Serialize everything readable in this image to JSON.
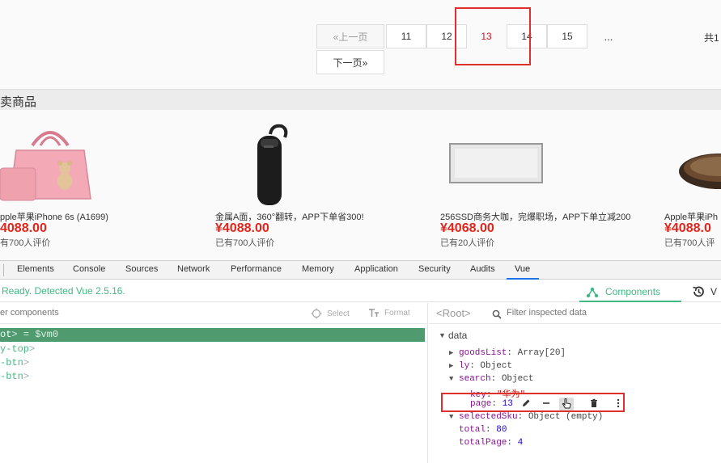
{
  "pagination": {
    "prev": "«上一页",
    "pages": [
      "11",
      "12",
      "13",
      "14",
      "15"
    ],
    "current": "13",
    "ellipsis": "...",
    "next": "下一页»",
    "total_fragment": "共1"
  },
  "section": {
    "title": "卖商品"
  },
  "products": [
    {
      "name": "pple苹果iPhone 6s (A1699)",
      "price": "4088.00",
      "reviews": "有700人评价",
      "image": "pink-handbag"
    },
    {
      "name": "金属A面，360°翻转，APP下单省300!",
      "price": "¥4088.00",
      "reviews": "已有700人评价",
      "image": "bluetooth-headset"
    },
    {
      "name": "256SSD商务大咖，完爆职场，APP下单立减200",
      "price": "¥4068.00",
      "reviews": "已有20人评价",
      "image": "led-panel"
    },
    {
      "name": "Apple苹果iPh",
      "price": "¥4088.0",
      "reviews": "已有700人评",
      "image": "frying-pan"
    }
  ],
  "devtools": {
    "tabs": [
      "Elements",
      "Console",
      "Sources",
      "Network",
      "Performance",
      "Memory",
      "Application",
      "Security",
      "Audits",
      "Vue"
    ],
    "active_tab": "Vue",
    "status": "Ready. Detected Vue 2.5.16.",
    "components_label": "Components",
    "vuex_label": "V",
    "filter_placeholder": "er components",
    "select_label": "Select",
    "format_label": "Format",
    "tree": [
      {
        "open": "ot",
        "close": "> = ",
        "ref": "$vm0",
        "selected": true
      },
      {
        "text": "y-top",
        "selected": false
      },
      {
        "text": "-btn",
        "selected": false
      },
      {
        "text": "-btn",
        "selected": false
      }
    ],
    "inspected": "<Root>",
    "inspect_placeholder": "Filter inspected data",
    "data_label": "data",
    "props": {
      "goodsList": {
        "key": "goodsList",
        "value": "Array[20]"
      },
      "ly": {
        "key": "ly",
        "value": "Object"
      },
      "search": {
        "key": "search",
        "value": "Object"
      },
      "search_key": {
        "key": "key",
        "value": "\"华为\""
      },
      "search_page": {
        "key": "page",
        "value": "13"
      },
      "selectedSku": {
        "key": "selectedSku",
        "value": "Object (empty)"
      },
      "total": {
        "key": "total",
        "value": "80"
      },
      "totalPage": {
        "key": "totalPage",
        "value": "4"
      }
    },
    "accent": "#42b983",
    "highlight": "#e0302b"
  }
}
